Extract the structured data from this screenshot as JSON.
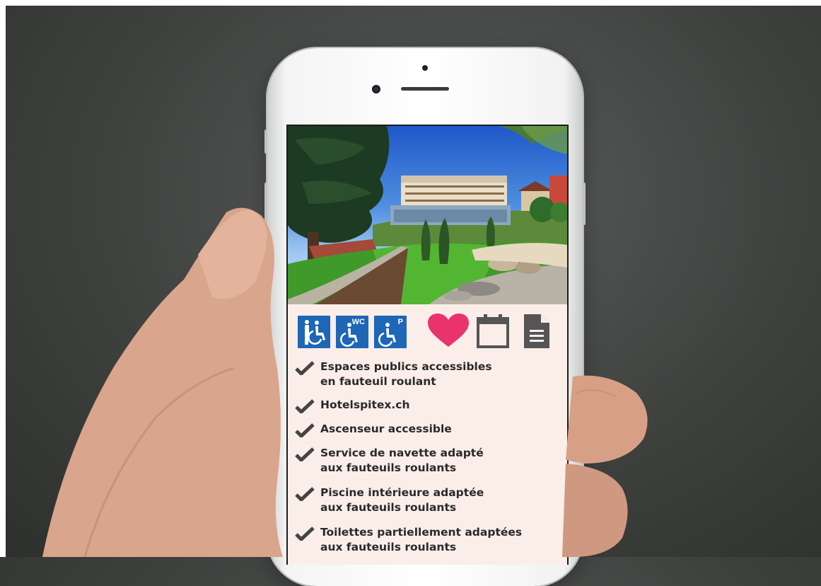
{
  "accessibility_icons": [
    {
      "name": "wheelchair-assistance-icon",
      "label": ""
    },
    {
      "name": "wheelchair-wc-icon",
      "label": "WC"
    },
    {
      "name": "wheelchair-parking-icon",
      "label": "P"
    }
  ],
  "actions": {
    "favorite_icon": "heart-icon",
    "calendar_icon": "calendar-icon",
    "document_icon": "document-icon"
  },
  "features": [
    "Espaces publics accessibles\nen fauteuil roulant",
    "Hotelspitex.ch",
    "Ascenseur accessible",
    "Service de navette adapté\naux fauteuils roulants",
    "Piscine intérieure adaptée\naux fauteuils roulants",
    "Toilettes partiellement adaptées\naux fauteuils roulants"
  ],
  "colors": {
    "accessibility_blue": "#1e66b6",
    "heart_pink": "#e8336e",
    "icon_gray": "#555555",
    "screen_background": "#fbeee8",
    "check_gray": "#444444"
  }
}
